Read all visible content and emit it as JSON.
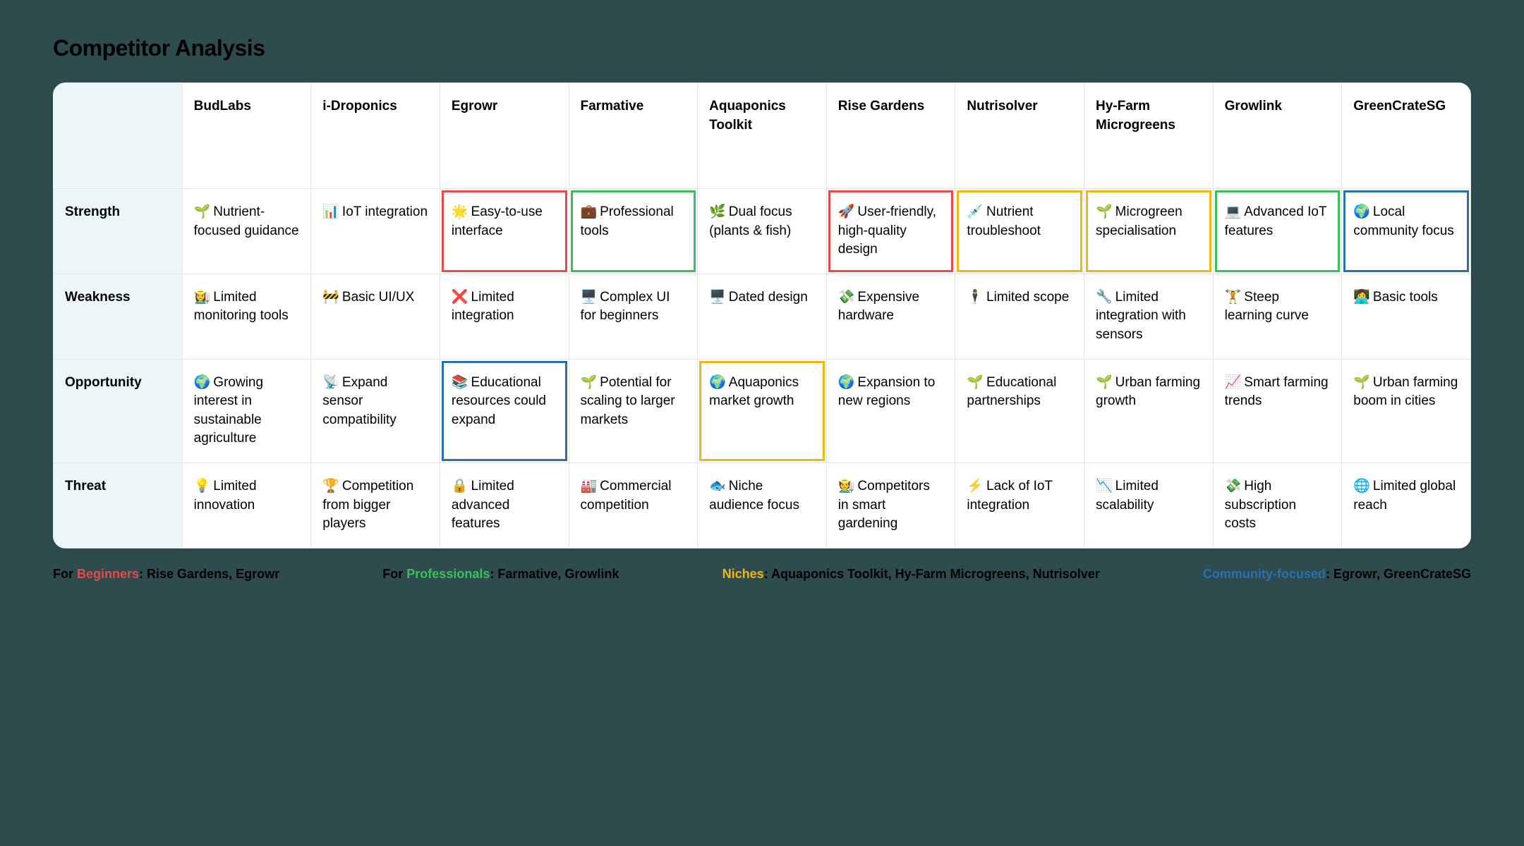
{
  "title": "Competitor Analysis",
  "columns": [
    "BudLabs",
    "i-Droponics",
    "Egrowr",
    "Farmative",
    "Aquaponics Toolkit",
    "Rise Gardens",
    "Nutrisolver",
    "Hy-Farm Microgreens",
    "Growlink",
    "GreenCrateSG"
  ],
  "rows": [
    {
      "label": "Strength",
      "cells": [
        {
          "emoji": "🌱",
          "text": "Nutrient-focused guidance",
          "highlight": null
        },
        {
          "emoji": "📊",
          "text": "IoT integration",
          "highlight": null
        },
        {
          "emoji": "🌟",
          "text": "Easy-to-use interface",
          "highlight": "red"
        },
        {
          "emoji": "💼",
          "text": "Professional tools",
          "highlight": "green"
        },
        {
          "emoji": "🌿",
          "text": "Dual focus (plants & fish)",
          "highlight": null
        },
        {
          "emoji": "🚀",
          "text": "User-friendly, high-quality design",
          "highlight": "red"
        },
        {
          "emoji": "💉",
          "text": "Nutrient troubleshoot",
          "highlight": "yellow"
        },
        {
          "emoji": "🌱",
          "text": "Microgreen specialisation",
          "highlight": "yellow"
        },
        {
          "emoji": "💻",
          "text": "Advanced IoT features",
          "highlight": "green"
        },
        {
          "emoji": "🌍",
          "text": "Local community focus",
          "highlight": "blue"
        }
      ]
    },
    {
      "label": "Weakness",
      "cells": [
        {
          "emoji": "👩‍🌾",
          "text": "Limited monitoring tools",
          "highlight": null
        },
        {
          "emoji": "🚧",
          "text": "Basic UI/UX",
          "highlight": null
        },
        {
          "emoji": "❌",
          "text": "Limited integration",
          "highlight": null
        },
        {
          "emoji": "🖥️",
          "text": "Complex UI for beginners",
          "highlight": null
        },
        {
          "emoji": "🖥️",
          "text": "Dated design",
          "highlight": null
        },
        {
          "emoji": "💸",
          "text": "Expensive hardware",
          "highlight": null
        },
        {
          "emoji": "🕴️",
          "text": "Limited scope",
          "highlight": null
        },
        {
          "emoji": "🔧",
          "text": "Limited integration with sensors",
          "highlight": null
        },
        {
          "emoji": "🏋️",
          "text": "Steep learning curve",
          "highlight": null
        },
        {
          "emoji": "👩‍💻",
          "text": "Basic tools",
          "highlight": null
        }
      ]
    },
    {
      "label": "Opportunity",
      "cells": [
        {
          "emoji": "🌍",
          "text": "Growing interest in sustainable agriculture",
          "highlight": null
        },
        {
          "emoji": "📡",
          "text": "Expand sensor compatibility",
          "highlight": null
        },
        {
          "emoji": "📚",
          "text": "Educational resources could expand",
          "highlight": "blue"
        },
        {
          "emoji": "🌱",
          "text": "Potential for scaling to larger markets",
          "highlight": null
        },
        {
          "emoji": "🌍",
          "text": "Aquaponics market growth",
          "highlight": "yellow"
        },
        {
          "emoji": "🌍",
          "text": "Expansion to new regions",
          "highlight": null
        },
        {
          "emoji": "🌱",
          "text": "Educational partnerships",
          "highlight": null
        },
        {
          "emoji": "🌱",
          "text": "Urban farming growth",
          "highlight": null
        },
        {
          "emoji": "📈",
          "text": "Smart farming trends",
          "highlight": null
        },
        {
          "emoji": "🌱",
          "text": "Urban farming boom in cities",
          "highlight": null
        }
      ]
    },
    {
      "label": "Threat",
      "cells": [
        {
          "emoji": "💡",
          "text": "Limited innovation",
          "highlight": null
        },
        {
          "emoji": "🏆",
          "text": "Competition from bigger players",
          "highlight": null
        },
        {
          "emoji": "🔒",
          "text": "Limited advanced features",
          "highlight": null
        },
        {
          "emoji": "🏭",
          "text": "Commercial competition",
          "highlight": null
        },
        {
          "emoji": "🐟",
          "text": "Niche audience focus",
          "highlight": null
        },
        {
          "emoji": "🧑‍🌾",
          "text": "Competitors in smart gardening",
          "highlight": null
        },
        {
          "emoji": "⚡",
          "text": "Lack of IoT integration",
          "highlight": null
        },
        {
          "emoji": "📉",
          "text": "Limited scalability",
          "highlight": null
        },
        {
          "emoji": "💸",
          "text": "High subscription costs",
          "highlight": null
        },
        {
          "emoji": "🌐",
          "text": "Limited global reach",
          "highlight": null
        }
      ]
    }
  ],
  "legend": [
    {
      "prefix": "For ",
      "colored": "Beginners",
      "color": "red",
      "suffix": ": Rise Gardens, Egrowr"
    },
    {
      "prefix": "For ",
      "colored": "Professionals",
      "color": "green",
      "suffix": ": Farmative, Growlink"
    },
    {
      "prefix": "",
      "colored": "Niches",
      "color": "yellow",
      "suffix": ": Aquaponics Toolkit, Hy-Farm Microgreens, Nutrisolver"
    },
    {
      "prefix": "",
      "colored": "Community-focused",
      "color": "blue",
      "suffix": ": Egrowr, GreenCrateSG"
    }
  ]
}
